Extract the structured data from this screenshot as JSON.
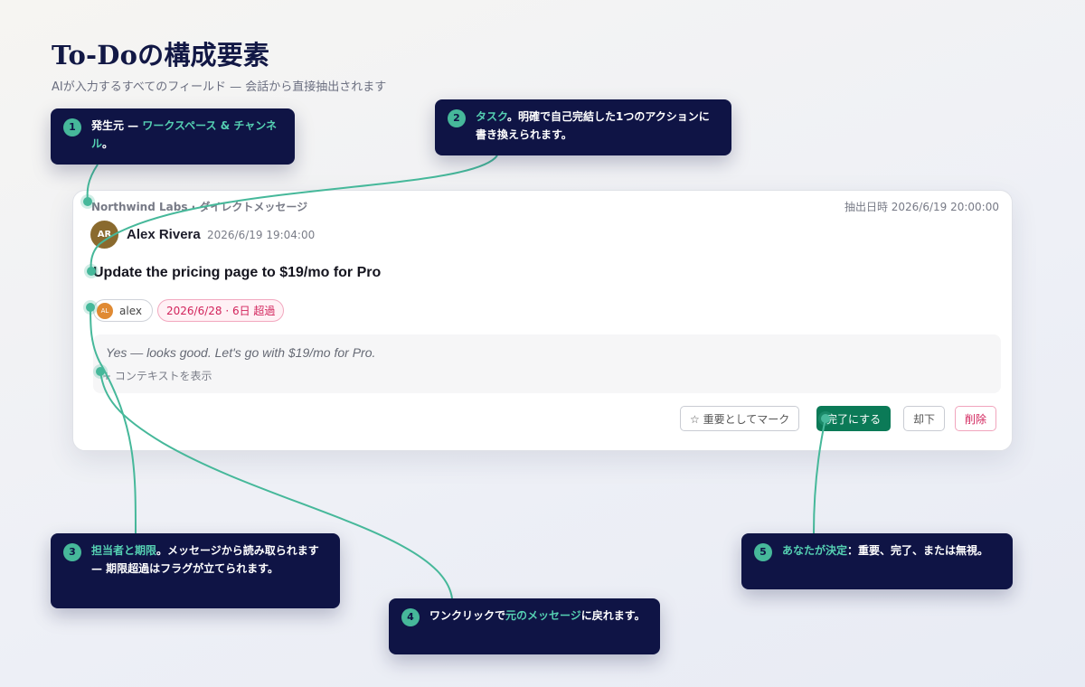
{
  "page": {
    "title": "To-Doの構成要素",
    "subtitle": "AIが入力するすべてのフィールド — 会話から直接抽出されます"
  },
  "card": {
    "source": "Northwind Labs · ダイレクトメッセージ",
    "extracted_at": "抽出日時 2026/6/19 20:00:00",
    "author": {
      "initials": "AR",
      "name": "Alex Rivera",
      "time": "2026/6/19 19:04:00"
    },
    "task": "Update the pricing page to $19/mo for Pro",
    "assignee": {
      "initials": "AL",
      "name": "alex"
    },
    "due": "2026/6/28 · 6日 超過",
    "quote": "Yes — looks good. Let's go with $19/mo for Pro.",
    "show_context": "+ コンテキストを表示",
    "buttons": {
      "star": "☆ 重要としてマーク",
      "done": "完了にする",
      "dismiss": "却下",
      "delete": "削除"
    }
  },
  "callouts": [
    {
      "number": "1",
      "prefix": "発生元 — ",
      "highlight": "ワークスペース & チャンネル",
      "suffix": "。"
    },
    {
      "number": "2",
      "prefix": "",
      "highlight": "タスク",
      "suffix": "。明確で自己完結した1つのアクションに書き換えられます。"
    },
    {
      "number": "3",
      "prefix": "",
      "highlight": "担当者と期限",
      "suffix": "。メッセージから読み取られます — 期限超過はフラグが立てられます。"
    },
    {
      "number": "4",
      "prefix": "ワンクリックで",
      "highlight": "元のメッセージ",
      "suffix": "に戻れます。"
    },
    {
      "number": "5",
      "prefix": "",
      "highlight": "あなたが決定",
      "suffix": "：重要、完了、または無視。"
    }
  ],
  "colors": {
    "accent": "#46b89a",
    "callout_bg": "#0f1445",
    "done_button": "#0b7a57",
    "overdue": "#d2245c"
  }
}
